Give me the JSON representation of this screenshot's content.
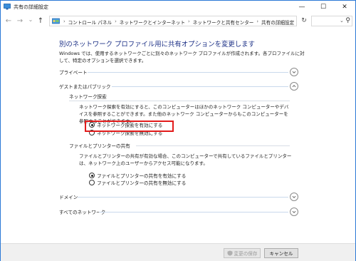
{
  "window": {
    "title": "共有の詳細設定",
    "minimize_glyph": "—",
    "maximize_glyph": "☐",
    "close_glyph": "✕"
  },
  "address": {
    "back_glyph": "←",
    "forward_glyph": "→",
    "dropdown_glyph": "⌄",
    "up_glyph": "↑",
    "path": [
      "コントロール パネル",
      "ネットワークとインターネット",
      "ネットワークと共有センター",
      "共有の詳細設定"
    ],
    "separator": "›",
    "path_dropdown_glyph": "⌄",
    "refresh_glyph": "↻",
    "search_placeholder": "",
    "search_glyph": "⚲"
  },
  "main": {
    "heading": "別のネットワーク プロファイル用に共有オプションを変更します",
    "description": "Windows では、使用するネットワークごとに別々のネットワーク プロファイルが作成されます。各プロファイルに対して、特定のオプションを選択できます。",
    "sections": {
      "private": "プライベート",
      "guest_public": "ゲストまたはパブリック",
      "domain": "ドメイン",
      "all_networks": "すべてのネットワーク"
    },
    "network_discovery": {
      "title": "ネットワーク探索",
      "text": "ネットワーク探索を有効にすると、このコンピューターはほかのネットワーク コンピューターやデバイスを参照することができます。また他のネットワーク コンピューターからもこのコンピューターを参照することができます。",
      "option_on": "ネットワーク探索を有効にする",
      "option_off": "ネットワーク探索を無効にする"
    },
    "file_printer": {
      "title": "ファイルとプリンターの共有",
      "text": "ファイルとプリンターの共有が有効な場合、このコンピューターで共有しているファイルとプリンターは、ネットワーク上のユーザーからアクセス可能になります。",
      "option_on": "ファイルとプリンターの共有を有効にする",
      "option_off": "ファイルとプリンターの共有を無効にする"
    }
  },
  "footer": {
    "save_label": "変更の保存",
    "cancel_label": "キャンセル"
  },
  "colors": {
    "heading": "#1e3287",
    "highlight": "#e21b1b",
    "window_border": "#2b79d6"
  }
}
